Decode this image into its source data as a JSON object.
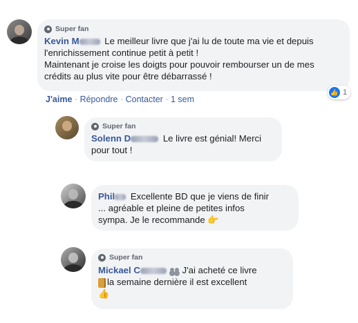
{
  "comments": [
    {
      "badge": "Super fan",
      "author_first": "Kevin M",
      "text_line1": "Le meilleur livre que j'ai lu de toute ma vie et depuis",
      "text_line2": "l'enrichissement continue petit à petit !",
      "text_line3": "Maintenant je croise les doigts pour pouvoir rembourser un de mes",
      "text_line4": "crédits au plus vite pour être débarrassé !",
      "actions": {
        "like": "J'aime",
        "reply": "Répondre",
        "contact": "Contacter",
        "time": "1 sem",
        "separator": "·"
      },
      "reaction_count": "1"
    },
    {
      "badge": "Super fan",
      "author_first": "Solenn D",
      "text_line1": "Le livre est génial! Merci",
      "text_line2": "pour tout !"
    },
    {
      "author_first": "Phil",
      "text_line1": "Excellente BD que je viens de finir",
      "text_line2": "... agréable et pleine de petites infos",
      "text_line3": "sympa. Je le recommande"
    },
    {
      "badge": "Super fan",
      "author_first": "Mickael C",
      "text_line1": "J'ai acheté ce livre",
      "text_line2": "la semaine dernière il est excellent"
    }
  ],
  "icons": {
    "badge": "super-fan-badge-icon",
    "like_reaction": "thumbs-up-icon",
    "pointing_hand": "backhand-pointing-icon",
    "book": "book-emoji-icon",
    "thumbs_up_emoji": "thumbs-up-emoji-icon",
    "people": "group-members-icon"
  },
  "colors": {
    "bubble": "#f2f3f5",
    "author": "#385898",
    "like_blue": "#1877f2",
    "meta_gray": "#90949c"
  }
}
